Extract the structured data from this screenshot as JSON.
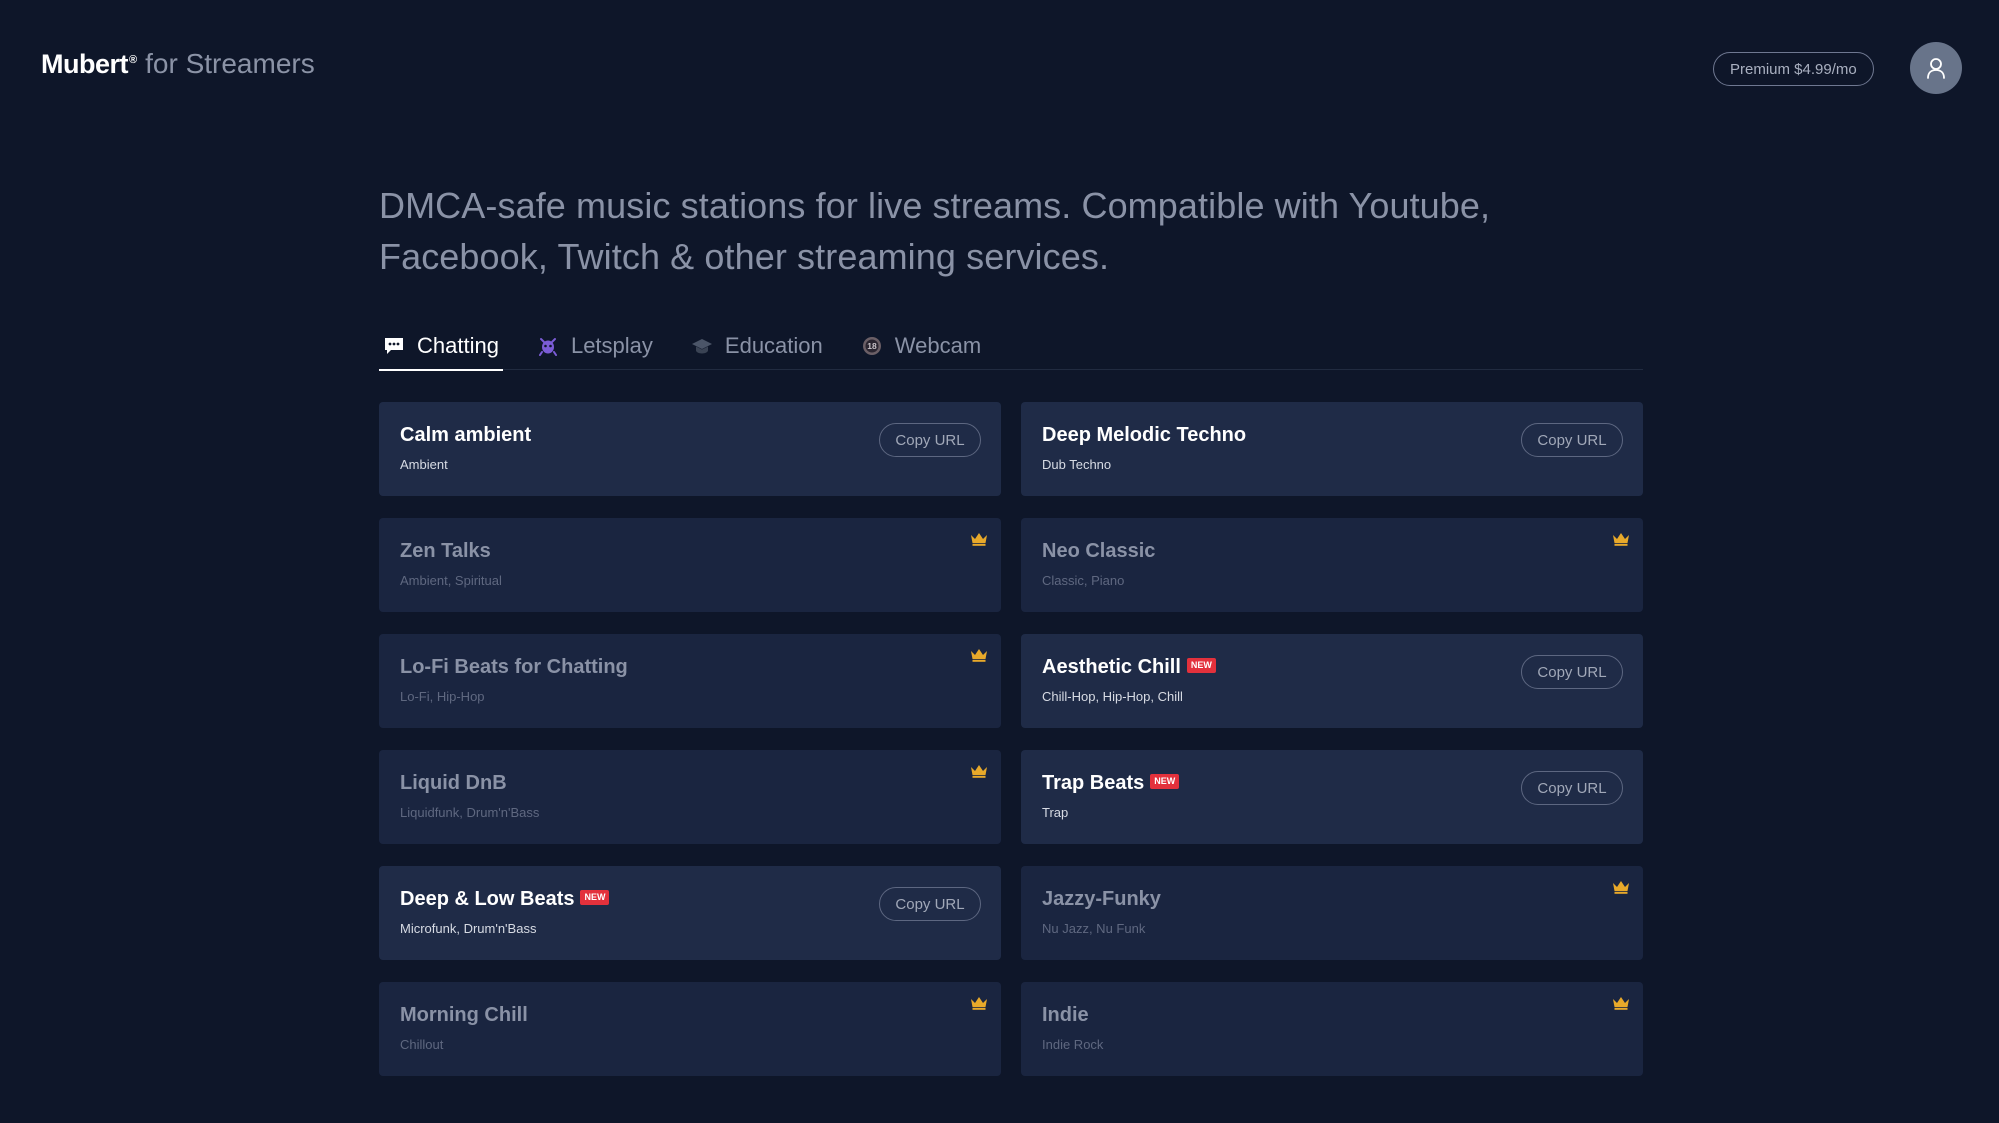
{
  "header": {
    "brand": "Mubert",
    "brand_mark": "®",
    "suffix": "for Streamers",
    "premium_label": "Premium $4.99/mo",
    "avatar_icon": "user-icon"
  },
  "hero": {
    "line1": "DMCA-safe music stations for live streams. Compatible with Youtube,",
    "line2": "Facebook, Twitch & other streaming services."
  },
  "tabs": [
    {
      "label": "Chatting",
      "icon": "chat-icon",
      "active": true
    },
    {
      "label": "Letsplay",
      "icon": "alien-icon",
      "active": false
    },
    {
      "label": "Education",
      "icon": "graduation-cap-icon",
      "active": false
    },
    {
      "label": "Webcam",
      "icon": "adult-18-icon",
      "active": false
    }
  ],
  "copy_label": "Copy URL",
  "new_label": "NEW",
  "stations": [
    {
      "title": "Calm ambient",
      "genres": "Ambient",
      "locked": false,
      "new": false
    },
    {
      "title": "Deep Melodic Techno",
      "genres": "Dub Techno",
      "locked": false,
      "new": false
    },
    {
      "title": "Zen Talks",
      "genres": "Ambient, Spiritual",
      "locked": true,
      "new": false
    },
    {
      "title": "Neo Classic",
      "genres": "Classic, Piano",
      "locked": true,
      "new": false
    },
    {
      "title": "Lo-Fi Beats for Chatting",
      "genres": "Lo-Fi, Hip-Hop",
      "locked": true,
      "new": false
    },
    {
      "title": "Aesthetic Chill",
      "genres": "Chill-Hop, Hip-Hop, Chill",
      "locked": false,
      "new": true
    },
    {
      "title": "Liquid DnB",
      "genres": "Liquidfunk, Drum'n'Bass",
      "locked": true,
      "new": false
    },
    {
      "title": "Trap Beats",
      "genres": "Trap",
      "locked": false,
      "new": true
    },
    {
      "title": "Deep & Low Beats",
      "genres": "Microfunk, Drum'n'Bass",
      "locked": false,
      "new": true
    },
    {
      "title": "Jazzy-Funky",
      "genres": "Nu Jazz, Nu Funk",
      "locked": true,
      "new": false
    },
    {
      "title": "Morning Chill",
      "genres": "Chillout",
      "locked": true,
      "new": false
    },
    {
      "title": "Indie",
      "genres": "Indie Rock",
      "locked": true,
      "new": false
    }
  ],
  "colors": {
    "background": "#0e1629",
    "card": "#1f2b47",
    "card_locked": "#1a2540",
    "crown": "#e8a92a",
    "new_badge": "#e3313c"
  }
}
